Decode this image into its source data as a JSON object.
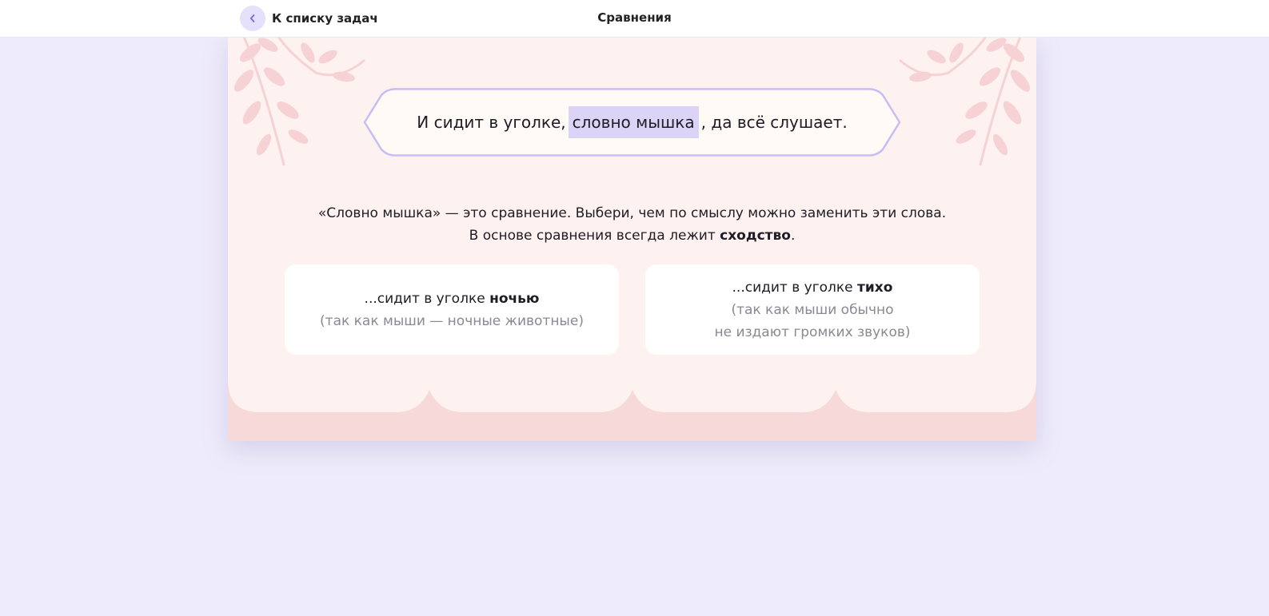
{
  "header": {
    "back_label": "К списку задач",
    "title": "Сравнения"
  },
  "task": {
    "sentence_before": "И сидит в уголке,",
    "sentence_highlight": "словно мышка",
    "sentence_after": ", да всё слушает.",
    "instruction_line1": "«Словно мышка» — это сравнение. Выбери, чем по смыслу можно заменить эти слова.",
    "instruction_line2_prefix": "В основе сравнения всегда лежит",
    "instruction_line2_bold": "сходство",
    "instruction_line2_suffix": "."
  },
  "options": [
    {
      "prefix": "...сидит в уголке",
      "bold": "ночью",
      "explanation_line1": "(так как мыши — ночные животные)",
      "explanation_line2": ""
    },
    {
      "prefix": "...сидит в уголке",
      "bold": "тихо",
      "explanation_line1": "(так как мыши обычно",
      "explanation_line2": "не издают громких звуков)"
    }
  ],
  "colors": {
    "page_background": "#eeebfa",
    "card_background": "#fdf2f0",
    "card_scallop": "#f8d9da",
    "leaf": "#f6d2d4",
    "banner_border": "#c8bdf3",
    "highlight": "#dcd4f7",
    "back_button_bg": "#e5e0fb",
    "accent_icon": "#7b68d8"
  },
  "icons": {
    "back": "chevron-left-icon"
  }
}
